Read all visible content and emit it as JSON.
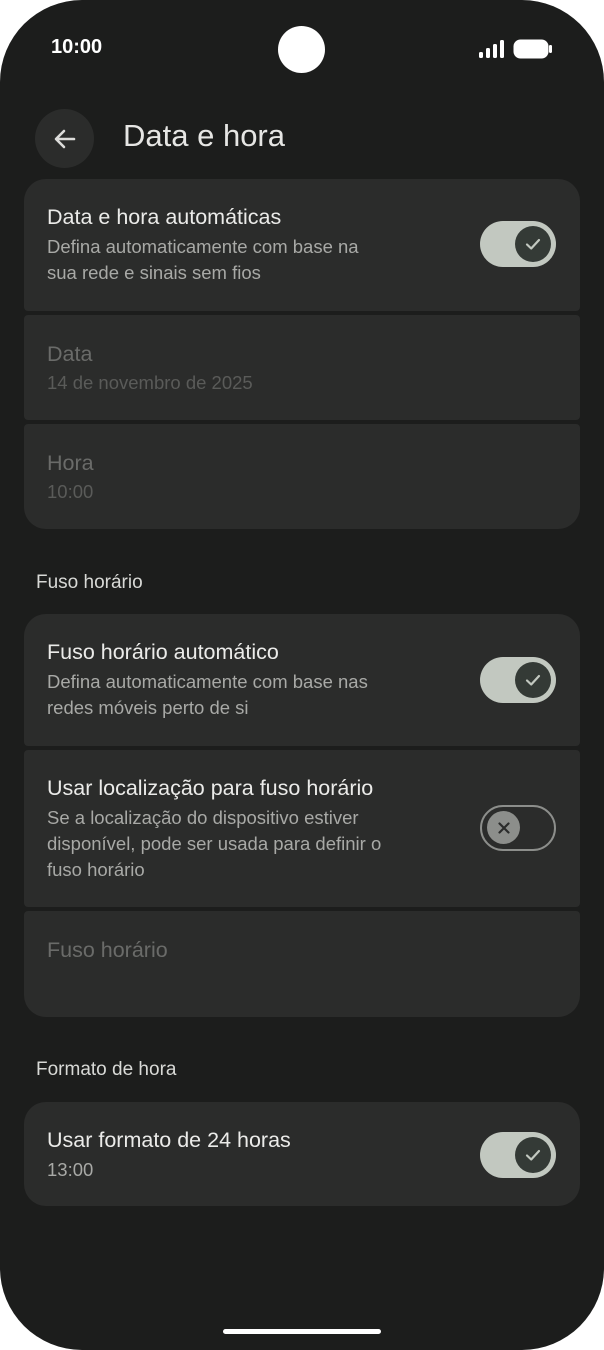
{
  "status_bar": {
    "time": "10:00"
  },
  "header": {
    "title": "Data e hora"
  },
  "groups": {
    "date_time": {
      "auto": {
        "title": "Data e hora automáticas",
        "subtitle_line1": "Defina automaticamente com base na",
        "subtitle_line2": "sua rede e sinais sem fios",
        "enabled": true
      },
      "date": {
        "title": "Data",
        "value": "14 de novembro de 2025"
      },
      "time": {
        "title": "Hora",
        "value": "10:00"
      }
    },
    "timezone": {
      "header": "Fuso horário",
      "auto": {
        "title": "Fuso horário automático",
        "subtitle_line1": "Defina automaticamente com base nas",
        "subtitle_line2": "redes móveis perto de si",
        "enabled": true
      },
      "use_location": {
        "title": "Usar localização para fuso horário",
        "subtitle_line1": "Se a localização do dispositivo estiver",
        "subtitle_line2": "disponível, pode ser usada para definir o",
        "subtitle_line3": "fuso horário",
        "enabled": false
      },
      "zone": {
        "title": "Fuso horário"
      }
    },
    "time_format": {
      "header": "Formato de hora",
      "use_24h": {
        "title": "Usar formato de 24 horas",
        "value": "13:00",
        "enabled": true
      }
    }
  },
  "icons": {
    "back": "arrow-left-icon",
    "check": "check-icon",
    "close": "close-icon",
    "signal": "signal-icon",
    "battery": "battery-icon"
  },
  "colors": {
    "background": "#1c1d1c",
    "card": "#2b2c2b",
    "toggle_on_track": "#c2c8c0",
    "toggle_on_thumb": "#343a36",
    "toggle_off": "#8c8e8b"
  }
}
